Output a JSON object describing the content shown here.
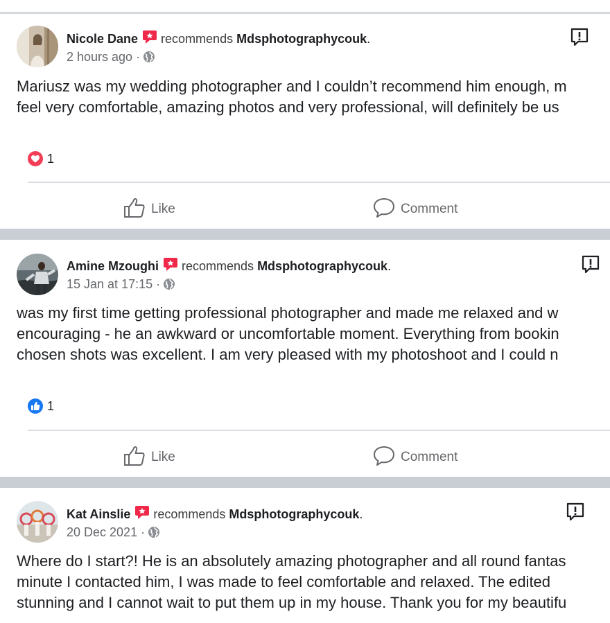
{
  "posts": [
    {
      "author": "Nicole Dane",
      "action_text": "recommends",
      "page": "Mdsphotographycouk",
      "period": ".",
      "timestamp": "2 hours ago ·",
      "body": [
        "Mariusz was my wedding photographer and I couldn’t recommend him enough, m",
        "feel very comfortable, amazing photos and very professional, will definitely be us"
      ],
      "reaction_type": "love",
      "reaction_count": "1",
      "like_label": "Like",
      "comment_label": "Comment"
    },
    {
      "author": "Amine Mzoughi",
      "action_text": "recommends",
      "page": "Mdsphotographycouk",
      "period": ".",
      "timestamp": "15 Jan at 17:15 ·",
      "body": [
        "was my first time getting professional photographer and made me relaxed and w",
        "encouraging - he an awkward or uncomfortable moment. Everything from bookin",
        "chosen shots was excellent. I am very pleased with my photoshoot and I could n"
      ],
      "reaction_type": "like",
      "reaction_count": "1",
      "like_label": "Like",
      "comment_label": "Comment"
    },
    {
      "author": "Kat Ainslie",
      "action_text": "recommends",
      "page": "Mdsphotographycouk",
      "period": ".",
      "timestamp": "20 Dec 2021 ·",
      "body": [
        "Where do I start?! He is an absolutely amazing photographer and all round fantas",
        "minute I contacted him, I was made to feel comfortable and relaxed. The edited",
        "stunning and I cannot wait to put them up in my house. Thank you for my beautifu"
      ]
    }
  ],
  "colors": {
    "recommend_badge": "#f02849",
    "love_reaction": "#f33e58",
    "like_reaction": "#1877f2",
    "separator": "#c9ced4",
    "secondary_text": "#65676b"
  },
  "icons": {
    "recommend": "recommend-badge-icon",
    "privacy": "globe-icon",
    "report": "report-icon",
    "love": "love-reaction-icon",
    "like": "like-reaction-icon",
    "like_action": "thumbs-up-icon",
    "comment_action": "comment-bubble-icon"
  }
}
